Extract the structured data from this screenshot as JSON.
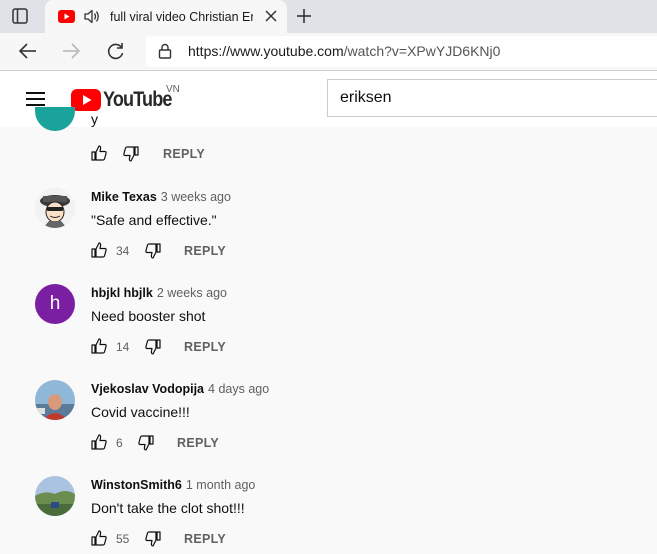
{
  "browser": {
    "tab_title": "full viral video Christian Eriksen",
    "url_host": "https://www.youtube.com",
    "url_path": "/watch?v=XPwYJD6KNj0"
  },
  "youtube": {
    "logo_text": "YouTube",
    "country_code": "VN",
    "search_value": "eriksen"
  },
  "comments": {
    "partial_text": "y",
    "reply_label": "REPLY",
    "items": [
      {
        "author": "Mike Texas",
        "time": "3 weeks ago",
        "text": "\"Safe and effective.\"",
        "likes": "34",
        "avatar": "cartoon-pilot"
      },
      {
        "author": "hbjkl hbjlk",
        "time": "2 weeks ago",
        "text": "Need booster shot",
        "likes": "14",
        "avatar_letter": "h",
        "avatar_color": "#7b1fa2"
      },
      {
        "author": "Vjekoslav Vodopija",
        "time": "4 days ago",
        "text": "Covid vaccine!!!",
        "likes": "6",
        "avatar": "photo-person"
      },
      {
        "author": "WinstonSmith6",
        "time": "1 month ago",
        "text": "Don't take the clot shot!!!",
        "likes": "55",
        "avatar": "photo-landscape"
      }
    ]
  },
  "colors": {
    "youtube_red": "#ff0000",
    "tab_bg": "#dfe3e8",
    "page_bg": "#f9f9f9"
  }
}
